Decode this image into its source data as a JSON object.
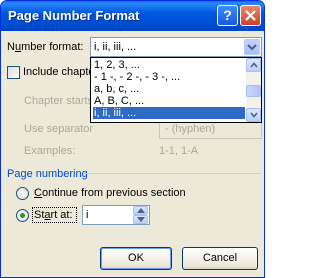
{
  "window": {
    "title": "Page Number Format",
    "help_glyph": "?",
    "close_glyph": "✕"
  },
  "number_format": {
    "label_before": "N",
    "label_underlined": "u",
    "label_after": "mber format:",
    "value": "i, ii, iii, ...",
    "options": [
      "1, 2, 3, ...",
      "- 1 -, - 2 -, - 3 -, ...",
      "a, b, c, ...",
      "A, B, C, ...",
      "i, ii, iii, ..."
    ],
    "selected_index": 4
  },
  "include_chapter": {
    "label": "Include chapte",
    "checked": false
  },
  "chapter_starts": {
    "label": "Chapter starts"
  },
  "use_separator": {
    "label": "Use separator",
    "value": "-   (hyphen)"
  },
  "examples": {
    "label": "Examples:",
    "value": "1-1, 1-A"
  },
  "page_numbering": {
    "group_label": "Page numbering",
    "continue_label_before": "",
    "continue_label_underlined": "C",
    "continue_label_after": "ontinue from previous section",
    "start_at_label_before": "St",
    "start_at_label_underlined": "a",
    "start_at_label_after": "rt at:",
    "start_at_value": "i",
    "selected": "start_at"
  },
  "buttons": {
    "ok": "OK",
    "cancel": "Cancel"
  },
  "colors": {
    "title_bar": "#0054e3",
    "dialog_face": "#ece9d8",
    "selection": "#316ac5",
    "radio_dot": "#21a121",
    "close_button": "#c8452a"
  }
}
